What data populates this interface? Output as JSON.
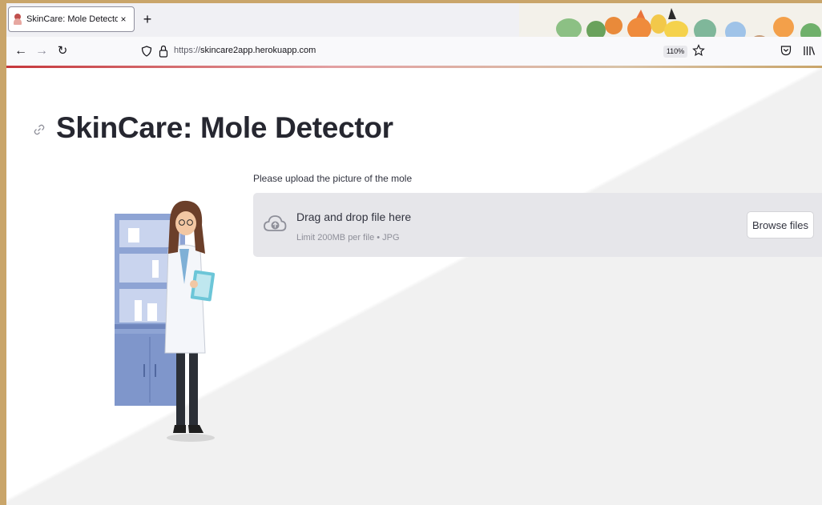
{
  "browser": {
    "tab_title": "SkinCare: Mole Detector App",
    "tab_close": "×",
    "new_tab": "+",
    "url_protocol": "https://",
    "url_host": "skincare2app.herokuapp.com",
    "zoom": "110%"
  },
  "page": {
    "title": "SkinCare: Mole Detector",
    "upload_label": "Please upload the picture of the mole",
    "dropzone_title": "Drag and drop file here",
    "dropzone_limit": "Limit 200MB per file • JPG",
    "browse_button": "Browse files"
  },
  "icons": {
    "back": "arrow-left-icon",
    "forward": "arrow-right-icon",
    "reload": "reload-icon",
    "shield": "shield-icon",
    "lock": "lock-icon",
    "star": "star-icon",
    "pocket": "pocket-icon",
    "library": "library-icon",
    "anchor": "link-icon",
    "upload": "cloud-upload-icon"
  },
  "colors": {
    "title": "#262730",
    "dropzone_bg": "#e6e6ea",
    "accent": "#c6373b"
  }
}
